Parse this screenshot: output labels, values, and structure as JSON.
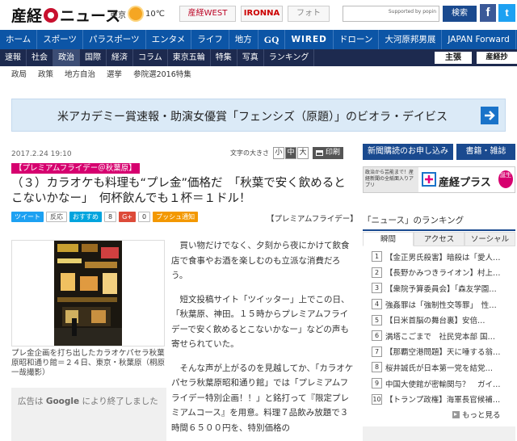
{
  "header": {
    "logo": "産経ニュース",
    "weather_city": "東京",
    "weather_icon": "sun-icon",
    "weather_temp": "10℃",
    "links": [
      "産経WEST",
      "IRONNA",
      "フォト"
    ],
    "search_placeholder": "",
    "search_powered": "Supported by popin",
    "search_button": "検索"
  },
  "nav_main": [
    "ホーム",
    "スポーツ",
    "パラスポーツ",
    "エンタメ",
    "ライフ",
    "地方",
    "GQ",
    "WIRED",
    "ドローン",
    "大河原邦男展",
    "JAPAN Forward"
  ],
  "nav_sub": [
    "速報",
    "社会",
    "政治",
    "国際",
    "経済",
    "コラム",
    "東京五輪",
    "特集",
    "写真",
    "ランキング"
  ],
  "nav_sub_active": "政治",
  "nav_sub_right": [
    "主張",
    "産経抄"
  ],
  "breadcrumb": [
    "政局",
    "政策",
    "地方自治",
    "選挙",
    "参院選2016特集"
  ],
  "banner": {
    "text": "米アカデミー賞速報・助演女優賞「フェンシズ（原題）」のビオラ・デイビス",
    "arrow_icon": "arrow-right-icon"
  },
  "article": {
    "date": "2017.2.24 19:10",
    "font_size_label": "文字の大きさ",
    "font_sizes": [
      "小",
      "中",
      "大"
    ],
    "print_label": "印刷",
    "tag": "【プレミアムフライデー＠秋葉原】",
    "headline": "（３）カラオケも料理も“プレ金”価格だ　「秋葉で安く飲めるとこないかなー」　何杯飲んでも１杯＝１ドル！",
    "series": "【プレミアムフライデー】",
    "social": {
      "tweet": "ツイート",
      "hanno": "反応",
      "recommend": "おすすめ",
      "recommend_count": "8",
      "gplus": "G+",
      "gplus_count": "0",
      "push": "プッシュ通知"
    },
    "photo_caption": "プレ金企画を打ち出したカラオケパセラ秋葉原昭和通り館＝２４日、東京・秋葉原（桐原一哉撮影）",
    "ad_notice_pre": "広告は",
    "ad_notice_brand": "Google",
    "ad_notice_post": "により終了しました",
    "paragraphs": [
      "買い物だけでなく、夕刻から夜にかけて飲食店で食事やお酒を楽しむのも立派な消費だろう。",
      "短文投稿サイト「ツイッター」上でこの日、「秋葉原、神田。１５時からプレミアムフライデーで安く飲めるとこないかなー」などの声も寄せられていた。",
      "そんな声が上がるのを見越してか、「カラオケパセラ秋葉原昭和通り館」では「プレミアムフライデー特別企画！！」と銘打って『限定プレミアムコース』を用意。料理７品飲み放題で３時間６５００円を、特別価格の"
    ]
  },
  "sidebar": {
    "buttons": [
      "新聞購読のお申し込み",
      "書籍・雑誌"
    ],
    "promo": {
      "left": "政治から芸能まで！産経新聞の全紙面入りアプリ",
      "name": "産経プラス",
      "badge": "誕生"
    },
    "ranking_title": "「ニュース」のランキング",
    "tabs": [
      "瞬間",
      "アクセス",
      "ソーシャル"
    ],
    "active_tab": "瞬間",
    "items": [
      {
        "rank": "1",
        "text": "【金正男氏殺害】暗殺は「愛人…"
      },
      {
        "rank": "2",
        "text": "【長野かみつきライオン】村上…"
      },
      {
        "rank": "3",
        "text": "【衆院予算委員会】「森友学園…"
      },
      {
        "rank": "4",
        "text": "強姦罪は「強制性交等罪」　性…"
      },
      {
        "rank": "5",
        "text": "【日米首脳の舞台裏】安倍…"
      },
      {
        "rank": "6",
        "text": "満塔こごまで　社民党本部 国…"
      },
      {
        "rank": "7",
        "text": "【那覇空港問題】天に唾する翁…"
      },
      {
        "rank": "8",
        "text": "桜井誠氏が日本第一党を結党…"
      },
      {
        "rank": "9",
        "text": "中国大使館が密輸関与？　ガイ…"
      },
      {
        "rank": "10",
        "text": "【トランプ政権】海軍長官候補…"
      }
    ],
    "more": "もっと見る"
  }
}
